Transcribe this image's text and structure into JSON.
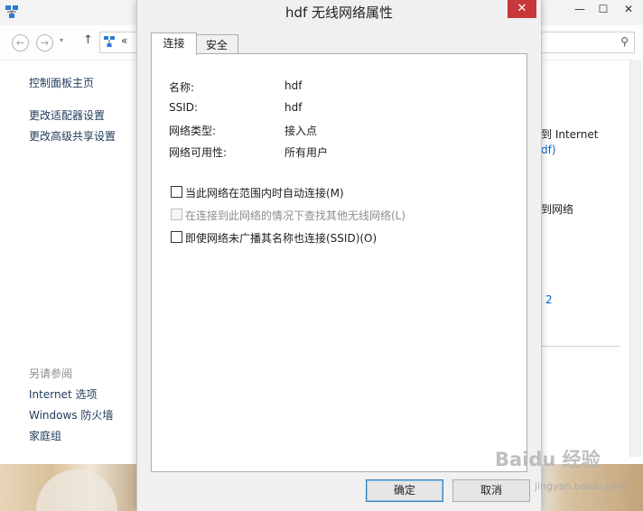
{
  "background_window": {
    "controls": {
      "minimize": "—",
      "maximize": "☐",
      "close": "✕"
    },
    "nav": {
      "back": "←",
      "forward": "→",
      "up": "↑",
      "breadcrumb_chevron": "«"
    },
    "left_pane": {
      "home": "控制面板主页",
      "change_adapter": "更改适配器设置",
      "change_sharing": "更改高级共享设置",
      "see_also": "另请参阅",
      "internet_options": "Internet 选项",
      "firewall": "Windows 防火墙",
      "homegroup": "家庭组"
    },
    "right_fragments": {
      "internet": "到 Internet",
      "df": "df)",
      "network": "到网络",
      "two": "2"
    }
  },
  "dialog": {
    "title": "hdf 无线网络属性",
    "close_glyph": "✕",
    "tabs": [
      {
        "label": "连接"
      },
      {
        "label": "安全"
      }
    ],
    "properties": [
      {
        "label": "名称:",
        "value": "hdf"
      },
      {
        "label": "SSID:",
        "value": "hdf"
      },
      {
        "label": "网络类型:",
        "value": "接入点"
      },
      {
        "label": "网络可用性:",
        "value": "所有用户"
      }
    ],
    "options": [
      {
        "label": "当此网络在范围内时自动连接(M)",
        "checked": false,
        "enabled": true
      },
      {
        "label": "在连接到此网络的情况下查找其他无线网络(L)",
        "checked": false,
        "enabled": false
      },
      {
        "label": "即使网络未广播其名称也连接(SSID)(O)",
        "checked": false,
        "enabled": true
      }
    ],
    "ok_label": "确定",
    "cancel_label": "取消"
  },
  "watermark": {
    "logo": "Baidu 经验",
    "url": "jingyan.baidu.com"
  },
  "colors": {
    "close_red": "#c7383a",
    "link_blue": "#0066cc",
    "dialog_bg": "#f0f0f0"
  }
}
